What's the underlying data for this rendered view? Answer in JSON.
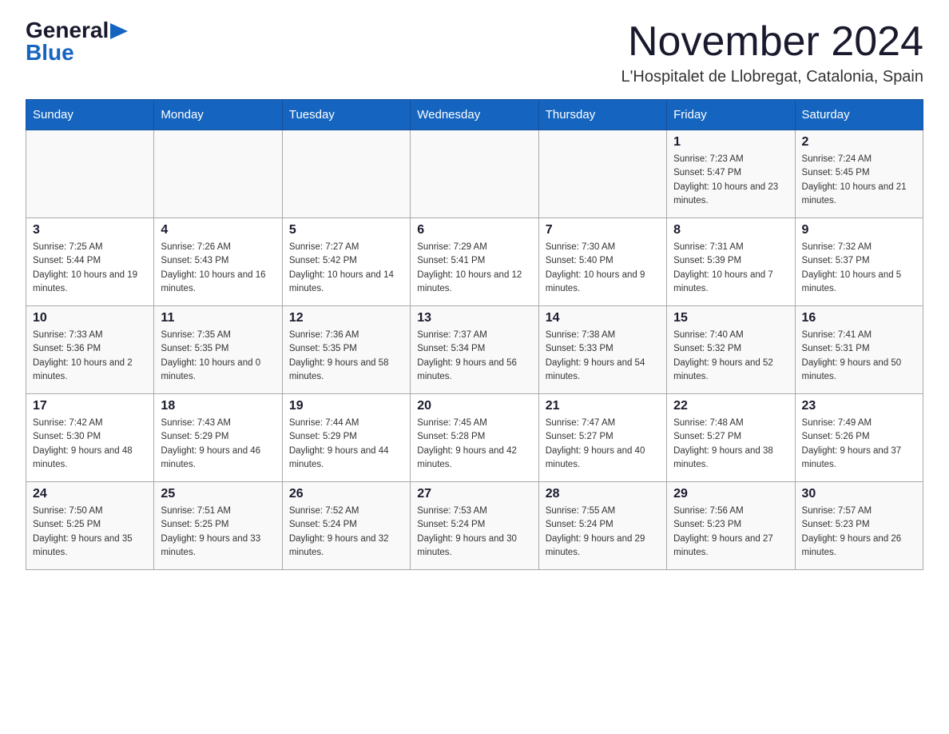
{
  "header": {
    "logo_general": "General",
    "logo_blue": "Blue",
    "month_title": "November 2024",
    "location": "L'Hospitalet de Llobregat, Catalonia, Spain"
  },
  "days_of_week": [
    "Sunday",
    "Monday",
    "Tuesday",
    "Wednesday",
    "Thursday",
    "Friday",
    "Saturday"
  ],
  "weeks": [
    {
      "days": [
        {
          "num": "",
          "sunrise": "",
          "sunset": "",
          "daylight": ""
        },
        {
          "num": "",
          "sunrise": "",
          "sunset": "",
          "daylight": ""
        },
        {
          "num": "",
          "sunrise": "",
          "sunset": "",
          "daylight": ""
        },
        {
          "num": "",
          "sunrise": "",
          "sunset": "",
          "daylight": ""
        },
        {
          "num": "",
          "sunrise": "",
          "sunset": "",
          "daylight": ""
        },
        {
          "num": "1",
          "sunrise": "Sunrise: 7:23 AM",
          "sunset": "Sunset: 5:47 PM",
          "daylight": "Daylight: 10 hours and 23 minutes."
        },
        {
          "num": "2",
          "sunrise": "Sunrise: 7:24 AM",
          "sunset": "Sunset: 5:45 PM",
          "daylight": "Daylight: 10 hours and 21 minutes."
        }
      ]
    },
    {
      "days": [
        {
          "num": "3",
          "sunrise": "Sunrise: 7:25 AM",
          "sunset": "Sunset: 5:44 PM",
          "daylight": "Daylight: 10 hours and 19 minutes."
        },
        {
          "num": "4",
          "sunrise": "Sunrise: 7:26 AM",
          "sunset": "Sunset: 5:43 PM",
          "daylight": "Daylight: 10 hours and 16 minutes."
        },
        {
          "num": "5",
          "sunrise": "Sunrise: 7:27 AM",
          "sunset": "Sunset: 5:42 PM",
          "daylight": "Daylight: 10 hours and 14 minutes."
        },
        {
          "num": "6",
          "sunrise": "Sunrise: 7:29 AM",
          "sunset": "Sunset: 5:41 PM",
          "daylight": "Daylight: 10 hours and 12 minutes."
        },
        {
          "num": "7",
          "sunrise": "Sunrise: 7:30 AM",
          "sunset": "Sunset: 5:40 PM",
          "daylight": "Daylight: 10 hours and 9 minutes."
        },
        {
          "num": "8",
          "sunrise": "Sunrise: 7:31 AM",
          "sunset": "Sunset: 5:39 PM",
          "daylight": "Daylight: 10 hours and 7 minutes."
        },
        {
          "num": "9",
          "sunrise": "Sunrise: 7:32 AM",
          "sunset": "Sunset: 5:37 PM",
          "daylight": "Daylight: 10 hours and 5 minutes."
        }
      ]
    },
    {
      "days": [
        {
          "num": "10",
          "sunrise": "Sunrise: 7:33 AM",
          "sunset": "Sunset: 5:36 PM",
          "daylight": "Daylight: 10 hours and 2 minutes."
        },
        {
          "num": "11",
          "sunrise": "Sunrise: 7:35 AM",
          "sunset": "Sunset: 5:35 PM",
          "daylight": "Daylight: 10 hours and 0 minutes."
        },
        {
          "num": "12",
          "sunrise": "Sunrise: 7:36 AM",
          "sunset": "Sunset: 5:35 PM",
          "daylight": "Daylight: 9 hours and 58 minutes."
        },
        {
          "num": "13",
          "sunrise": "Sunrise: 7:37 AM",
          "sunset": "Sunset: 5:34 PM",
          "daylight": "Daylight: 9 hours and 56 minutes."
        },
        {
          "num": "14",
          "sunrise": "Sunrise: 7:38 AM",
          "sunset": "Sunset: 5:33 PM",
          "daylight": "Daylight: 9 hours and 54 minutes."
        },
        {
          "num": "15",
          "sunrise": "Sunrise: 7:40 AM",
          "sunset": "Sunset: 5:32 PM",
          "daylight": "Daylight: 9 hours and 52 minutes."
        },
        {
          "num": "16",
          "sunrise": "Sunrise: 7:41 AM",
          "sunset": "Sunset: 5:31 PM",
          "daylight": "Daylight: 9 hours and 50 minutes."
        }
      ]
    },
    {
      "days": [
        {
          "num": "17",
          "sunrise": "Sunrise: 7:42 AM",
          "sunset": "Sunset: 5:30 PM",
          "daylight": "Daylight: 9 hours and 48 minutes."
        },
        {
          "num": "18",
          "sunrise": "Sunrise: 7:43 AM",
          "sunset": "Sunset: 5:29 PM",
          "daylight": "Daylight: 9 hours and 46 minutes."
        },
        {
          "num": "19",
          "sunrise": "Sunrise: 7:44 AM",
          "sunset": "Sunset: 5:29 PM",
          "daylight": "Daylight: 9 hours and 44 minutes."
        },
        {
          "num": "20",
          "sunrise": "Sunrise: 7:45 AM",
          "sunset": "Sunset: 5:28 PM",
          "daylight": "Daylight: 9 hours and 42 minutes."
        },
        {
          "num": "21",
          "sunrise": "Sunrise: 7:47 AM",
          "sunset": "Sunset: 5:27 PM",
          "daylight": "Daylight: 9 hours and 40 minutes."
        },
        {
          "num": "22",
          "sunrise": "Sunrise: 7:48 AM",
          "sunset": "Sunset: 5:27 PM",
          "daylight": "Daylight: 9 hours and 38 minutes."
        },
        {
          "num": "23",
          "sunrise": "Sunrise: 7:49 AM",
          "sunset": "Sunset: 5:26 PM",
          "daylight": "Daylight: 9 hours and 37 minutes."
        }
      ]
    },
    {
      "days": [
        {
          "num": "24",
          "sunrise": "Sunrise: 7:50 AM",
          "sunset": "Sunset: 5:25 PM",
          "daylight": "Daylight: 9 hours and 35 minutes."
        },
        {
          "num": "25",
          "sunrise": "Sunrise: 7:51 AM",
          "sunset": "Sunset: 5:25 PM",
          "daylight": "Daylight: 9 hours and 33 minutes."
        },
        {
          "num": "26",
          "sunrise": "Sunrise: 7:52 AM",
          "sunset": "Sunset: 5:24 PM",
          "daylight": "Daylight: 9 hours and 32 minutes."
        },
        {
          "num": "27",
          "sunrise": "Sunrise: 7:53 AM",
          "sunset": "Sunset: 5:24 PM",
          "daylight": "Daylight: 9 hours and 30 minutes."
        },
        {
          "num": "28",
          "sunrise": "Sunrise: 7:55 AM",
          "sunset": "Sunset: 5:24 PM",
          "daylight": "Daylight: 9 hours and 29 minutes."
        },
        {
          "num": "29",
          "sunrise": "Sunrise: 7:56 AM",
          "sunset": "Sunset: 5:23 PM",
          "daylight": "Daylight: 9 hours and 27 minutes."
        },
        {
          "num": "30",
          "sunrise": "Sunrise: 7:57 AM",
          "sunset": "Sunset: 5:23 PM",
          "daylight": "Daylight: 9 hours and 26 minutes."
        }
      ]
    }
  ]
}
